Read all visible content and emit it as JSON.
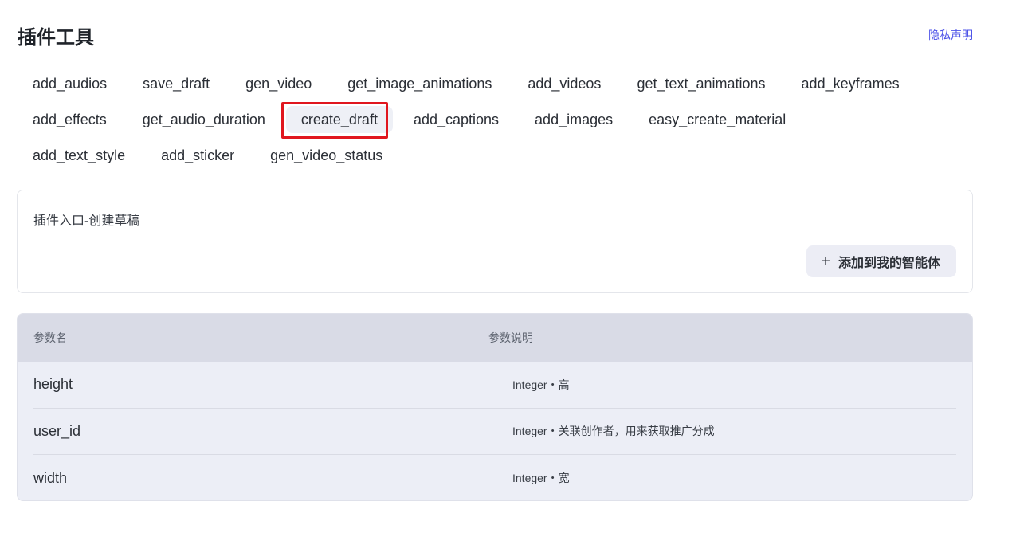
{
  "header": {
    "title": "插件工具",
    "privacy_link": "隐私声明"
  },
  "tools": {
    "rows": [
      [
        "add_audios",
        "save_draft",
        "gen_video",
        "get_image_animations",
        "add_videos",
        "get_text_animations",
        "add_keyframes"
      ],
      [
        "add_effects",
        "get_audio_duration",
        "create_draft",
        "add_captions",
        "add_images",
        "easy_create_material"
      ],
      [
        "add_text_style",
        "add_sticker",
        "gen_video_status"
      ]
    ],
    "selected": "create_draft"
  },
  "entry": {
    "title": "插件入口-创建草稿",
    "add_button_label": "添加到我的智能体",
    "add_button_icon": "plus-icon"
  },
  "params": {
    "headers": {
      "name": "参数名",
      "description": "参数说明"
    },
    "rows": [
      {
        "name": "height",
        "description": "Integer・高"
      },
      {
        "name": "user_id",
        "description": "Integer・关联创作者，用来获取推广分成"
      },
      {
        "name": "width",
        "description": "Integer・宽"
      }
    ]
  },
  "colors": {
    "accent": "#4d53e8",
    "highlight_box": "#e0161e",
    "table_header_bg": "#d9dbe6",
    "table_body_bg": "#eceef6"
  }
}
